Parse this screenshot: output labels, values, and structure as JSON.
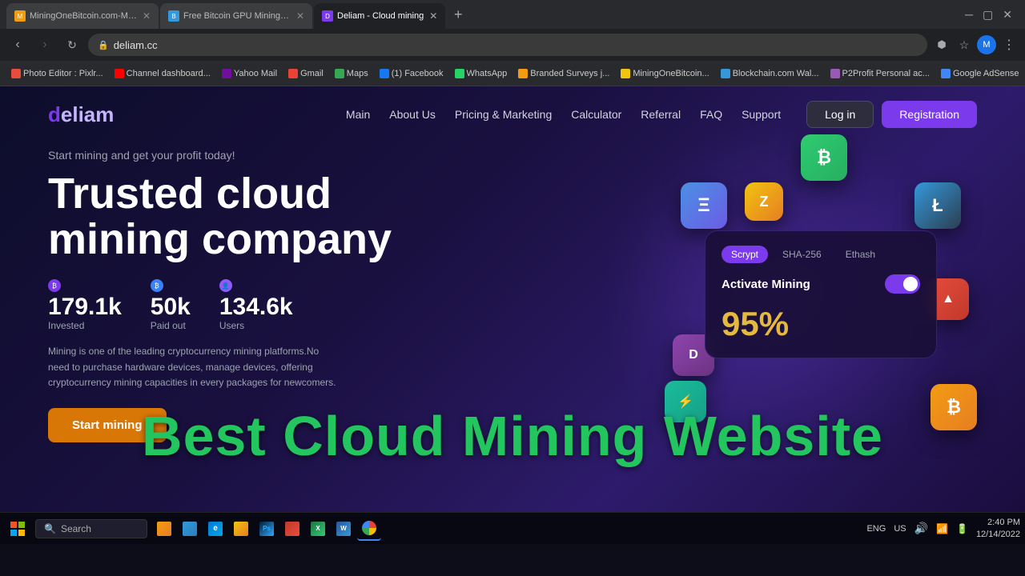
{
  "browser": {
    "tabs": [
      {
        "id": "tab1",
        "title": "MiningOneBitcoin.com-Mining...",
        "active": false,
        "favicon": "M"
      },
      {
        "id": "tab2",
        "title": "Free Bitcoin GPU Mining, Cloud...",
        "active": false,
        "favicon": "B"
      },
      {
        "id": "tab3",
        "title": "Deliam - Cloud mining",
        "active": true,
        "favicon": "D"
      }
    ],
    "address": "deliam.cc",
    "bookmarks": [
      "Photo Editor : Pixlr...",
      "Channel dashboard...",
      "Yahoo Mail",
      "Gmail",
      "Maps",
      "(1) Facebook",
      "WhatsApp",
      "Branded Surveys j...",
      "MiningOneBitcoin...",
      "Blockchain.com Wal...",
      "P2Profit Personal ac...",
      "Google AdSense"
    ]
  },
  "site": {
    "logo": "deliam",
    "nav": {
      "links": [
        "Main",
        "About Us",
        "Pricing & Marketing",
        "Calculator",
        "Referral",
        "FAQ",
        "Support"
      ],
      "login_label": "Log in",
      "register_label": "Registration"
    },
    "hero": {
      "subtitle": "Start mining and get your profit today!",
      "title": "Trusted cloud mining company",
      "stats": [
        {
          "value": "179.1k",
          "label": "Invested"
        },
        {
          "value": "50k",
          "label": "Paid out"
        },
        {
          "value": "134.6k",
          "label": "Users"
        }
      ],
      "description": "Mining is one of the leading cryptocurrency mining platforms.No need to purchase hardware devices, manage devices, offering cryptocurrency mining capacities in every packages for newcomers.",
      "cta_label": "Start mining"
    },
    "mining_card": {
      "tabs": [
        "Scrypt",
        "SHA-256",
        "Ethash"
      ],
      "active_tab": "Scrypt",
      "toggle_label": "Activate Mining",
      "percent": "95%"
    },
    "overlay_text": "Best Cloud Mining Website"
  },
  "taskbar": {
    "search_placeholder": "Search",
    "time": "2:40 PM",
    "date": "12/14/2022",
    "language": "ENG",
    "region": "US"
  },
  "crypto_icons": [
    {
      "symbol": "Ξ",
      "color_start": "#4a90e2",
      "color_end": "#6c5ce7",
      "name": "ethereum"
    },
    {
      "symbol": "₿",
      "color_start": "#2ecc71",
      "color_end": "#27ae60",
      "name": "bitcoin"
    },
    {
      "symbol": "Z",
      "color_start": "#f1c40f",
      "color_end": "#e67e22",
      "name": "zcash"
    },
    {
      "symbol": "Ł",
      "color_start": "#3498db",
      "color_end": "#2c3e50",
      "name": "litecoin"
    },
    {
      "symbol": "▲",
      "color_start": "#e74c3c",
      "color_end": "#c0392b",
      "name": "tron"
    },
    {
      "symbol": "D",
      "color_start": "#8e44ad",
      "color_end": "#6c3483",
      "name": "dogecoin"
    }
  ]
}
